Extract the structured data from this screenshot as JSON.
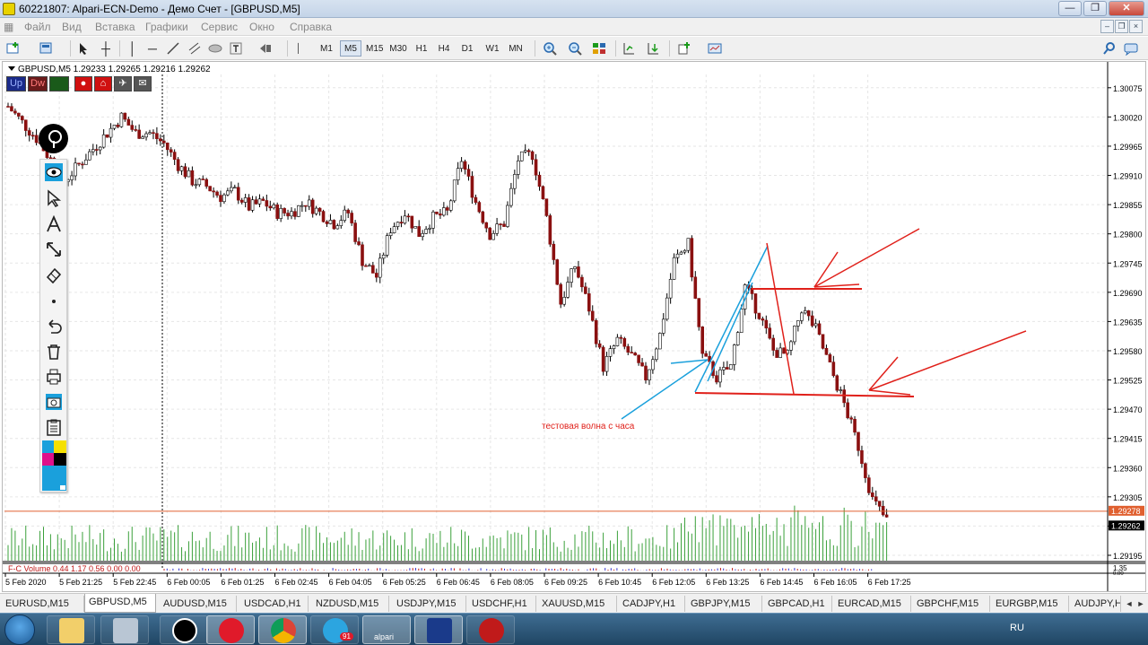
{
  "window": {
    "title": "60221807: Alpari-ECN-Demo - Демо Счет - [GBPUSD,M5]",
    "buttons": {
      "minimize": "—",
      "maximize": "❐",
      "close": "✕"
    }
  },
  "menu": [
    "Файл",
    "Вид",
    "Вставка",
    "Графики",
    "Сервис",
    "Окно",
    "Справка"
  ],
  "mdi": {
    "minimize": "–",
    "restore": "❐",
    "close": "×"
  },
  "timeframes": [
    "M1",
    "M5",
    "M15",
    "M30",
    "H1",
    "H4",
    "D1",
    "W1",
    "MN"
  ],
  "active_timeframe": "M5",
  "chart": {
    "symbol_header": "GBPUSD,M5  1.29233 1.29265 1.29216 1.29262",
    "indicator_buttons": [
      "Up",
      "Dw",
      "..."
    ],
    "volume_label": "F-C Volume 0.44 1.17 0.56 0.00 0.00",
    "annotation": "тестовая волна с часа",
    "bid_label": "1.29278",
    "ask_label": "1.29262",
    "sub_labels": [
      "1.35",
      "0.00"
    ]
  },
  "chart_data": {
    "type": "candlestick",
    "symbol": "GBPUSD",
    "timeframe": "M5",
    "ohlc_current": {
      "open": 1.29233,
      "high": 1.29265,
      "low": 1.29216,
      "close": 1.29262
    },
    "ylim": [
      1.29195,
      1.301
    ],
    "y_ticks": [
      "1.30075",
      "1.30020",
      "1.29965",
      "1.29910",
      "1.29855",
      "1.29800",
      "1.29745",
      "1.29690",
      "1.29635",
      "1.29580",
      "1.29525",
      "1.29470",
      "1.29415",
      "1.29360",
      "1.29305",
      "1.29250",
      "1.29195"
    ],
    "x_ticks": [
      "5 Feb 2020",
      "5 Feb 21:25",
      "5 Feb 22:45",
      "6 Feb 00:05",
      "6 Feb 01:25",
      "6 Feb 02:45",
      "6 Feb 04:05",
      "6 Feb 05:25",
      "6 Feb 06:45",
      "6 Feb 08:05",
      "6 Feb 09:25",
      "6 Feb 10:45",
      "6 Feb 12:05",
      "6 Feb 13:25",
      "6 Feb 14:45",
      "6 Feb 16:05",
      "6 Feb 17:25"
    ],
    "close_path": [
      1.3004,
      1.3001,
      1.2998,
      1.2994,
      1.299,
      1.2993,
      1.2996,
      1.2999,
      1.3002,
      1.2999,
      1.2999,
      1.2997,
      1.2993,
      1.299,
      1.2989,
      1.2987,
      1.2988,
      1.2985,
      1.2986,
      1.2984,
      1.2984,
      1.2986,
      1.2984,
      1.2982,
      1.2984,
      1.2975,
      1.2972,
      1.2981,
      1.2984,
      1.298,
      1.2983,
      1.2984,
      1.2994,
      1.2986,
      1.298,
      1.2982,
      1.2994,
      1.2995,
      1.2983,
      1.2967,
      1.2974,
      1.2966,
      1.2955,
      1.296,
      1.2957,
      1.2953,
      1.2961,
      1.2975,
      1.2978,
      1.2957,
      1.2953,
      1.2955,
      1.297,
      1.2965,
      1.2958,
      1.2957,
      1.2966,
      1.2962,
      1.2955,
      1.2948,
      1.294,
      1.293,
      1.2926
    ],
    "bid": 1.29278,
    "ask": 1.29262,
    "volume_scale": [
      0,
      1.35
    ]
  },
  "side_tools": [
    "pin-icon",
    "eye-icon",
    "cursor-icon",
    "text-icon",
    "arrow-icon",
    "eraser-icon",
    "dot-icon",
    "undo-icon",
    "trash-icon",
    "printer-icon",
    "camera-icon",
    "clipboard-icon",
    "palette-icon"
  ],
  "tabs": [
    "EURUSD,M15",
    "GBPUSD,M5",
    "AUDUSD,M15",
    "USDCAD,H1",
    "NZDUSD,M15",
    "USDJPY,M15",
    "USDCHF,H1",
    "XAUUSD,M15",
    "CADJPY,H1",
    "GBPJPY,M15",
    "GBPCAD,H1",
    "EURCAD,M15",
    "GBPCHF,M15",
    "EURGBP,M15",
    "AUDJPY,H"
  ],
  "active_tab": "GBPUSD,M5",
  "taskbar": {
    "apps": [
      "pin-app",
      "folder",
      "calculator",
      "pin-app-2",
      "opera",
      "chrome",
      "telegram",
      "alpari",
      "metatrader",
      "app"
    ],
    "telegram_badge": "91",
    "alpari_label": "alpari",
    "lang": "RU"
  }
}
